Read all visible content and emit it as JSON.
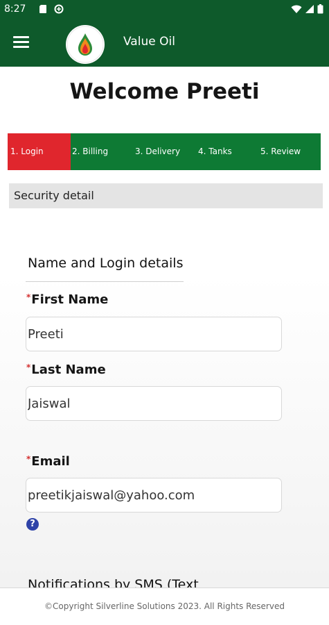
{
  "status_bar": {
    "time": "8:27"
  },
  "app_bar": {
    "title": "Value Oil"
  },
  "page": {
    "welcome": "Welcome Preeti"
  },
  "steps": [
    {
      "label": "1. Login",
      "active": true
    },
    {
      "label": "2. Billing",
      "active": false
    },
    {
      "label": "3. Delivery",
      "active": false
    },
    {
      "label": "4. Tanks",
      "active": false
    },
    {
      "label": "5. Review",
      "active": false
    }
  ],
  "section": {
    "title": "Security detail"
  },
  "form": {
    "group_title": "Name and Login details",
    "required_mark": "*",
    "first_name": {
      "label": "First Name",
      "value": "Preeti"
    },
    "last_name": {
      "label": "Last Name",
      "value": "Jaiswal"
    },
    "email": {
      "label": "Email",
      "value": "preetikjaiswal@yahoo.com"
    },
    "help_glyph": "?",
    "notifications_title": "Notifications by SMS (Text"
  },
  "footer": {
    "text": "©Copyright Silverline Solutions 2023. All Rights Reserved"
  },
  "colors": {
    "header_green": "#0e5a2b",
    "stepper_green": "#0e7a34",
    "active_step_red": "#e0262d",
    "help_blue": "#2f43a8"
  }
}
